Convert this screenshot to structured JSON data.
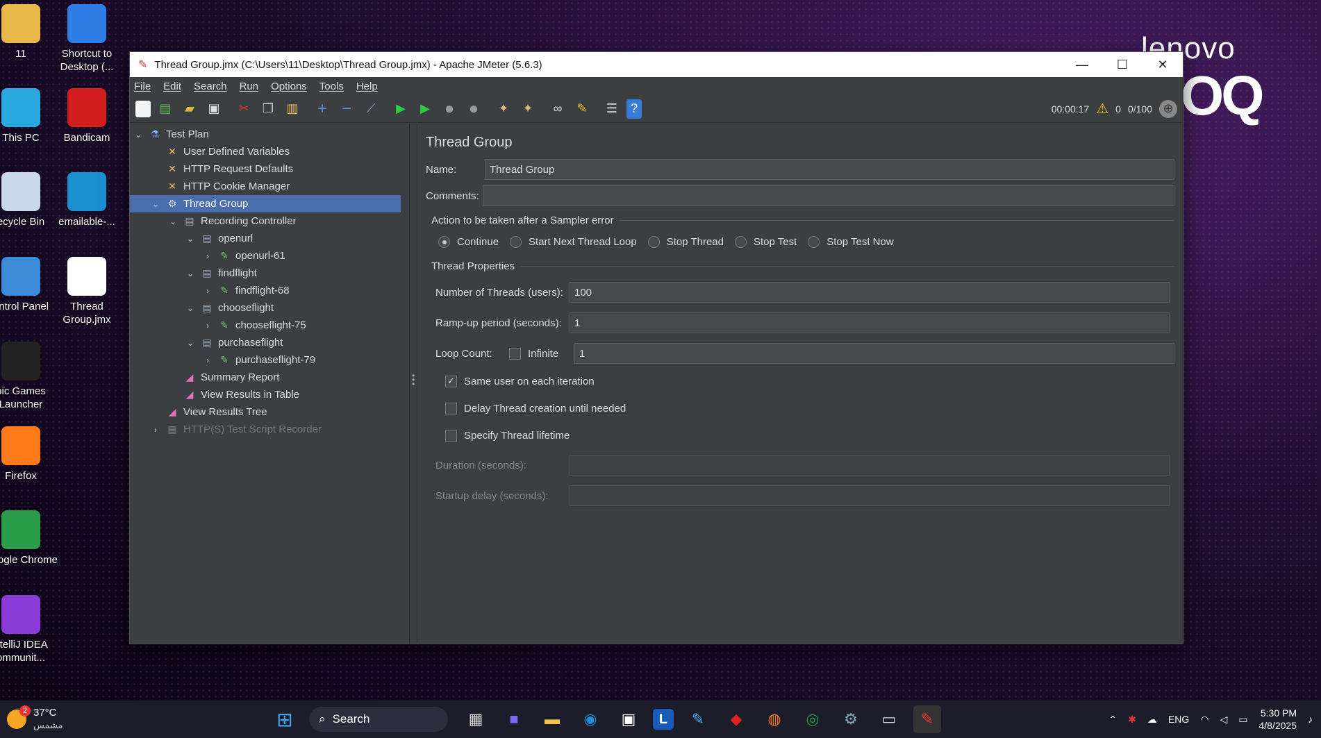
{
  "desktop": {
    "icons": [
      {
        "label": "11",
        "icon": "user-folder-icon",
        "color": "#e8b94a"
      },
      {
        "label": "Shortcut to Desktop (...",
        "icon": "onedrive-icon",
        "color": "#2f7ee6"
      },
      {
        "label": "This PC",
        "icon": "monitor-icon",
        "color": "#2aa8e0"
      },
      {
        "label": "Bandicam",
        "icon": "record-icon",
        "color": "#d21e1e"
      },
      {
        "label": "ecycle Bin",
        "icon": "recycle-bin-icon",
        "color": "#c8d8e8"
      },
      {
        "label": "emailable-...",
        "icon": "edge-icon",
        "color": "#1b8fd0"
      },
      {
        "label": "ontrol Panel",
        "icon": "control-panel-icon",
        "color": "#3b8bd6"
      },
      {
        "label": "Thread Group.jmx",
        "icon": "file-icon",
        "color": "#ffffff"
      },
      {
        "label": "pic Games Launcher",
        "icon": "epic-games-icon",
        "color": "#222222"
      },
      {
        "label": "Firefox",
        "icon": "firefox-icon",
        "color": "#ff7a1a"
      },
      {
        "label": "Google Chrome",
        "icon": "chrome-icon",
        "color": "#2a9d4a"
      },
      {
        "label": "ntelliJ IDEA ommunit...",
        "icon": "intellij-icon",
        "color": "#8b3bd6"
      }
    ],
    "brand_text": "lenovo",
    "brand_logo": "OQ"
  },
  "window": {
    "title": "Thread Group.jmx (C:\\Users\\11\\Desktop\\Thread Group.jmx) - Apache JMeter (5.6.3)",
    "controls": {
      "minimize": "—",
      "maximize": "☐",
      "close": "✕"
    }
  },
  "menu": [
    "File",
    "Edit",
    "Search",
    "Run",
    "Options",
    "Tools",
    "Help"
  ],
  "toolbar": {
    "buttons": [
      "new-icon",
      "templates-icon",
      "open-icon",
      "save-icon",
      "cut-icon",
      "copy-icon",
      "paste-icon",
      "expand-icon",
      "collapse-icon",
      "toggle-icon",
      "start-icon",
      "start-no-pause-icon",
      "stop-icon",
      "shutdown-icon",
      "clear-icon",
      "clear-all-icon",
      "search-icon",
      "reset-search-icon",
      "function-helper-icon",
      "help-icon"
    ],
    "timer": "00:00:17",
    "warnings": "0",
    "threads": "0/100"
  },
  "tree": [
    {
      "label": "Test Plan",
      "level": 0,
      "arrow": "⌄",
      "icon": "test-plan-icon",
      "selected": false,
      "disabled": false
    },
    {
      "label": "User Defined Variables",
      "level": 1,
      "arrow": "",
      "icon": "config-icon",
      "selected": false,
      "disabled": false
    },
    {
      "label": "HTTP Request Defaults",
      "level": 1,
      "arrow": "",
      "icon": "config-icon",
      "selected": false,
      "disabled": false
    },
    {
      "label": "HTTP Cookie Manager",
      "level": 1,
      "arrow": "",
      "icon": "config-icon",
      "selected": false,
      "disabled": false
    },
    {
      "label": "Thread Group",
      "level": 1,
      "arrow": "⌄",
      "icon": "thread-group-icon",
      "selected": true,
      "disabled": false
    },
    {
      "label": "Recording Controller",
      "level": 2,
      "arrow": "⌄",
      "icon": "controller-icon",
      "selected": false,
      "disabled": false
    },
    {
      "label": "openurl",
      "level": 3,
      "arrow": "⌄",
      "icon": "controller-icon",
      "selected": false,
      "disabled": false
    },
    {
      "label": "openurl-61",
      "level": 4,
      "arrow": "›",
      "icon": "sampler-icon",
      "selected": false,
      "disabled": false
    },
    {
      "label": "findflight",
      "level": 3,
      "arrow": "⌄",
      "icon": "controller-icon",
      "selected": false,
      "disabled": false
    },
    {
      "label": "findflight-68",
      "level": 4,
      "arrow": "›",
      "icon": "sampler-icon",
      "selected": false,
      "disabled": false
    },
    {
      "label": "chooseflight",
      "level": 3,
      "arrow": "⌄",
      "icon": "controller-icon",
      "selected": false,
      "disabled": false
    },
    {
      "label": "chooseflight-75",
      "level": 4,
      "arrow": "›",
      "icon": "sampler-icon",
      "selected": false,
      "disabled": false
    },
    {
      "label": "purchaseflight",
      "level": 3,
      "arrow": "⌄",
      "icon": "controller-icon",
      "selected": false,
      "disabled": false
    },
    {
      "label": "purchaseflight-79",
      "level": 4,
      "arrow": "›",
      "icon": "sampler-icon",
      "selected": false,
      "disabled": false
    },
    {
      "label": "Summary Report",
      "level": 2,
      "arrow": "",
      "icon": "listener-icon",
      "selected": false,
      "disabled": false
    },
    {
      "label": "View Results in Table",
      "level": 2,
      "arrow": "",
      "icon": "listener-icon",
      "selected": false,
      "disabled": false
    },
    {
      "label": "View Results Tree",
      "level": 1,
      "arrow": "",
      "icon": "listener-icon",
      "selected": false,
      "disabled": false
    },
    {
      "label": "HTTP(S) Test Script Recorder",
      "level": 1,
      "arrow": "›",
      "icon": "recorder-icon",
      "selected": false,
      "disabled": true
    }
  ],
  "panel": {
    "title": "Thread Group",
    "name_label": "Name:",
    "name_value": "Thread Group",
    "comments_label": "Comments:",
    "comments_value": "",
    "error_action_title": "Action to be taken after a Sampler error",
    "error_actions": [
      {
        "label": "Continue",
        "checked": true
      },
      {
        "label": "Start Next Thread Loop",
        "checked": false
      },
      {
        "label": "Stop Thread",
        "checked": false
      },
      {
        "label": "Stop Test",
        "checked": false
      },
      {
        "label": "Stop Test Now",
        "checked": false
      }
    ],
    "thread_props_title": "Thread Properties",
    "threads_label": "Number of Threads (users):",
    "threads_value": "100",
    "rampup_label": "Ramp-up period (seconds):",
    "rampup_value": "1",
    "loop_label": "Loop Count:",
    "infinite_label": "Infinite",
    "loop_value": "1",
    "same_user_label": "Same user on each iteration",
    "delay_label": "Delay Thread creation until needed",
    "lifetime_label": "Specify Thread lifetime",
    "duration_label": "Duration (seconds):",
    "startup_label": "Startup delay (seconds):"
  },
  "taskbar": {
    "weather_temp": "37°C",
    "weather_desc": "مشمس",
    "weather_badge": "2",
    "search_label": "Search",
    "apps": [
      "windows-start-icon",
      "widgets-icon",
      "file-explorer-icon",
      "teams-icon",
      "folder-icon",
      "edge-icon",
      "store-icon",
      "l-app-icon",
      "code-app-icon",
      "mcafee-icon",
      "firefox-icon",
      "chrome-icon",
      "settings-icon",
      "terminal-icon",
      "jmeter-icon"
    ],
    "lang": "ENG",
    "time": "5:30 PM",
    "date": "4/8/2025"
  }
}
